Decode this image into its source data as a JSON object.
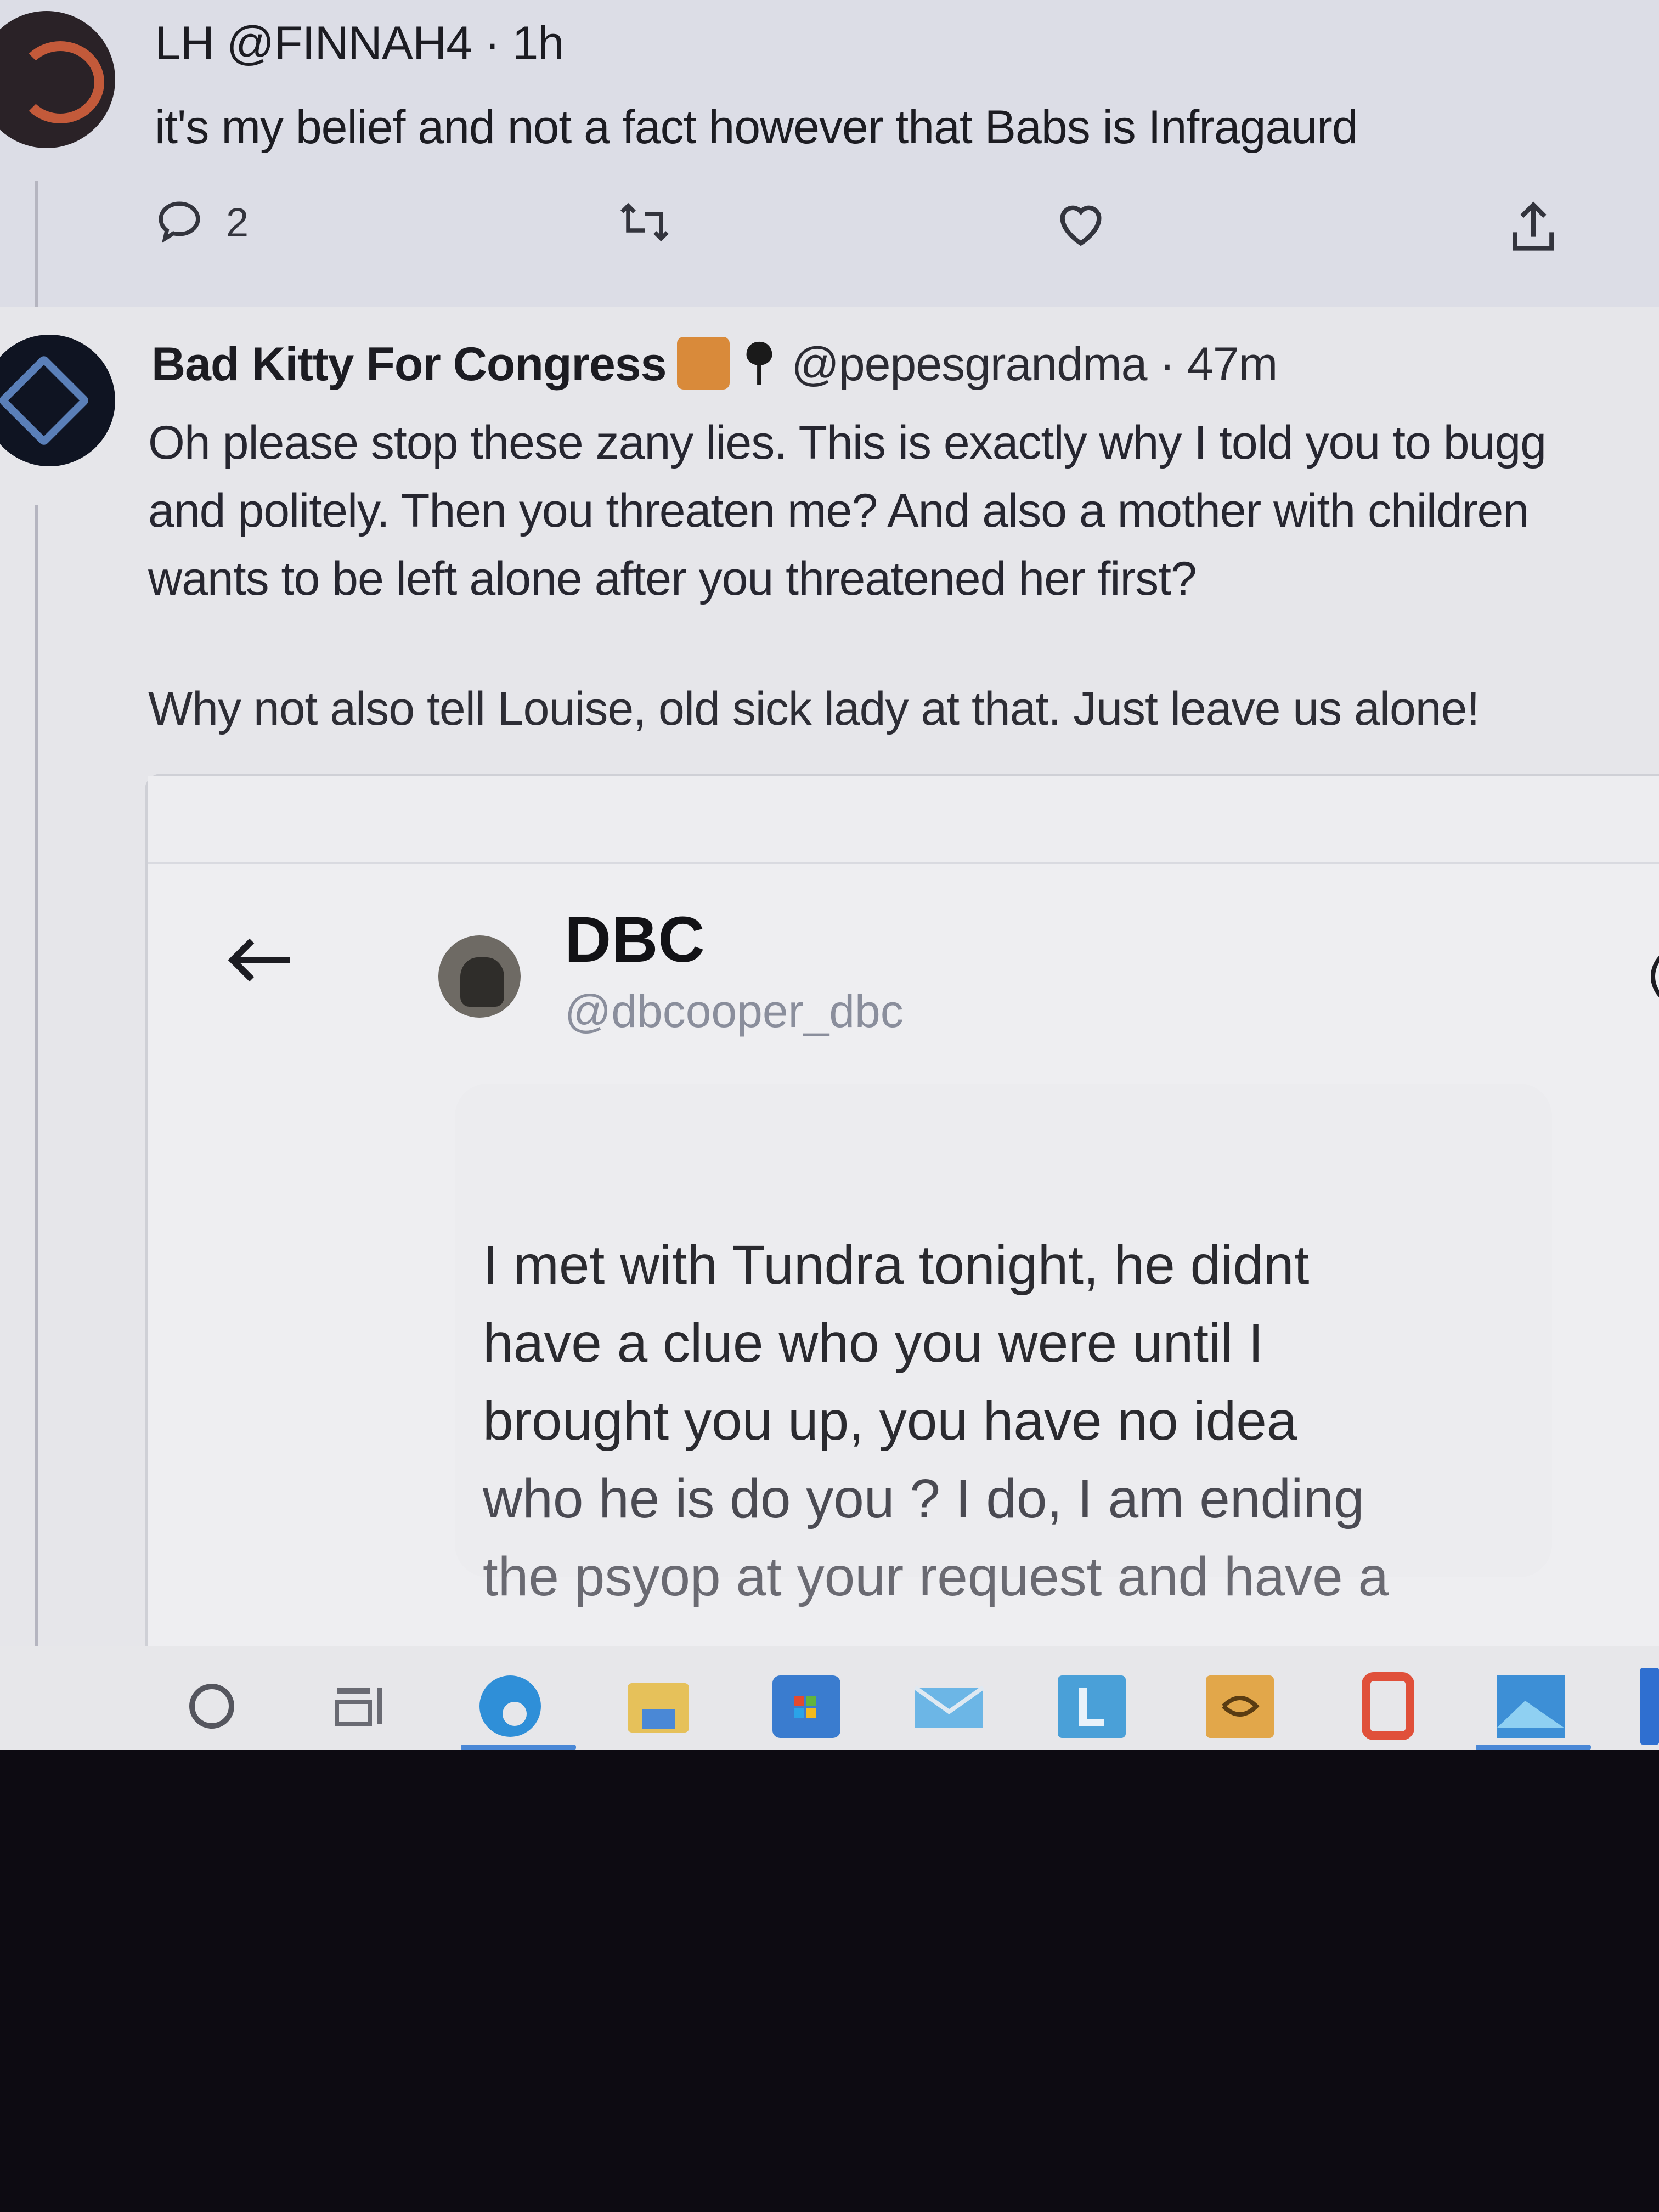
{
  "tweet1": {
    "name": "LH",
    "handle": "@FINNAH4",
    "time": "· 1h",
    "text": "it's my belief and not a fact however that Babs is Infragaurd",
    "reply_count": "2"
  },
  "tweet2": {
    "name": "Bad Kitty For Congress",
    "handle": "@pepesgrandma",
    "time": "· 47m",
    "lines": [
      "Oh please stop these zany lies. This is exactly why I told you to bugg",
      "and politely. Then you threaten me? And also a mother with children",
      "wants to be left alone after you threatened her first?"
    ],
    "line2": "Why not also tell Louise, old sick lady at that. Just leave us alone!"
  },
  "embed": {
    "dm_name": "DBC",
    "dm_handle": "@dbcooper_dbc",
    "message_lines": [
      "I met with Tundra tonight, he didnt",
      "have a clue who you were until I",
      "brought  you up, you have no idea",
      "who he is do you ? I do, I am ending",
      "the psyop at your request and have a"
    ]
  },
  "icons": {
    "reply": "reply-icon",
    "retweet": "retweet-icon",
    "like": "heart-icon",
    "share": "share-icon",
    "back": "back-arrow-icon",
    "info": "info-icon"
  },
  "taskbar": {
    "items": [
      "start",
      "task-view",
      "edge",
      "file-explorer",
      "store",
      "mail",
      "app-l",
      "app-yellow",
      "office",
      "photos"
    ]
  },
  "colors": {
    "accent": "#4a88d6",
    "muted_handle": "#8a8e9c"
  }
}
